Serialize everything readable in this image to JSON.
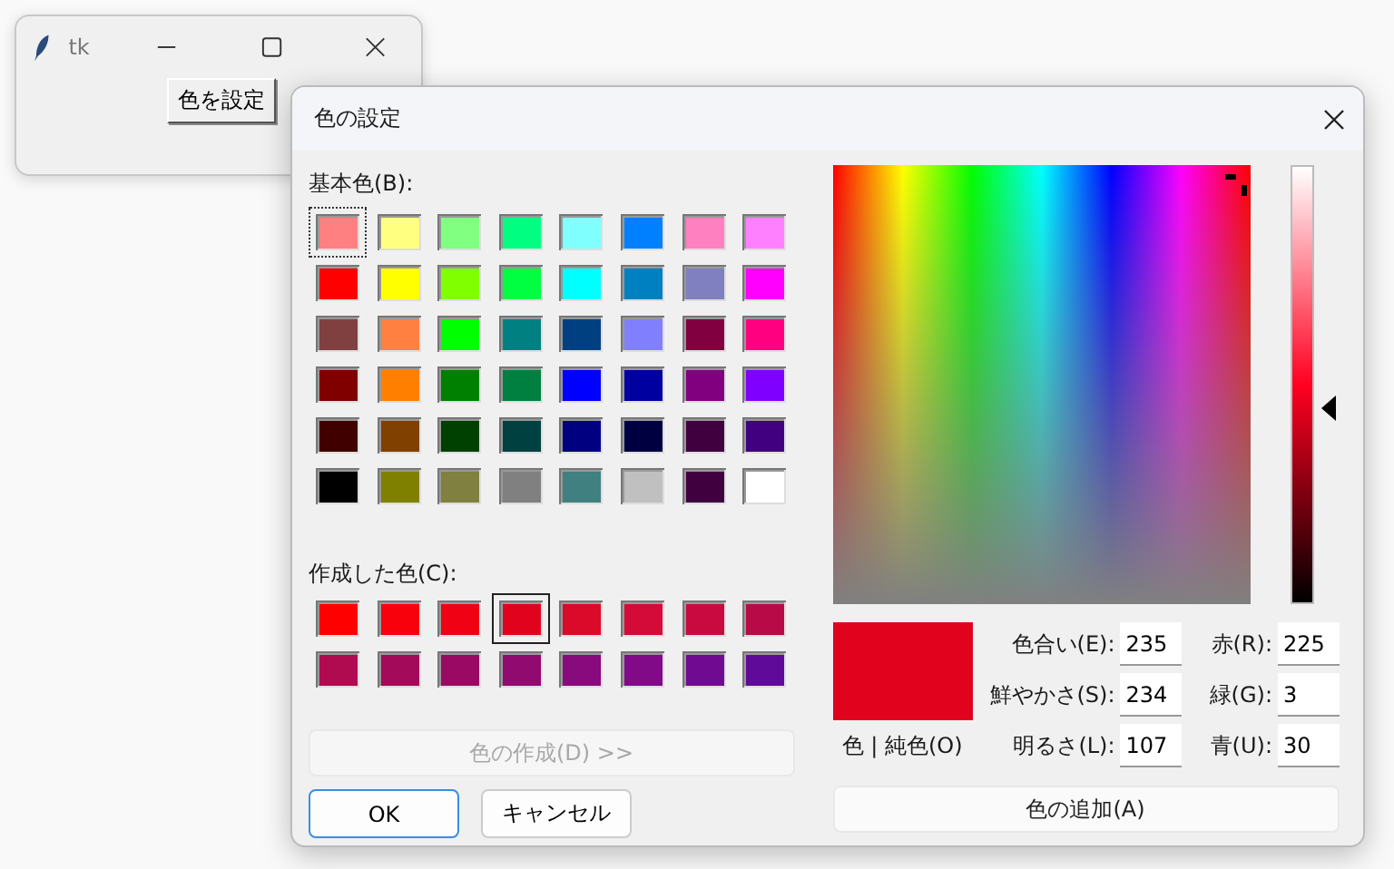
{
  "main_window": {
    "title": "tk",
    "button": "色を設定"
  },
  "dialog": {
    "title": "色の設定",
    "basic_label": "基本色(B):",
    "basic_colors": [
      {
        "color": "#ff8080",
        "selected": true
      },
      {
        "color": "#ffff80",
        "selected": false
      },
      {
        "color": "#80ff80",
        "selected": false
      },
      {
        "color": "#00ff80",
        "selected": false
      },
      {
        "color": "#80ffff",
        "selected": false
      },
      {
        "color": "#0080ff",
        "selected": false
      },
      {
        "color": "#ff80c0",
        "selected": false
      },
      {
        "color": "#ff80ff",
        "selected": false
      },
      {
        "color": "#ff0000",
        "selected": false
      },
      {
        "color": "#ffff00",
        "selected": false
      },
      {
        "color": "#80ff00",
        "selected": false
      },
      {
        "color": "#00ff40",
        "selected": false
      },
      {
        "color": "#00ffff",
        "selected": false
      },
      {
        "color": "#0080c0",
        "selected": false
      },
      {
        "color": "#8080c0",
        "selected": false
      },
      {
        "color": "#ff00ff",
        "selected": false
      },
      {
        "color": "#804040",
        "selected": false
      },
      {
        "color": "#ff8040",
        "selected": false
      },
      {
        "color": "#00ff00",
        "selected": false
      },
      {
        "color": "#008080",
        "selected": false
      },
      {
        "color": "#004080",
        "selected": false
      },
      {
        "color": "#8080ff",
        "selected": false
      },
      {
        "color": "#800040",
        "selected": false
      },
      {
        "color": "#ff0080",
        "selected": false
      },
      {
        "color": "#800000",
        "selected": false
      },
      {
        "color": "#ff8000",
        "selected": false
      },
      {
        "color": "#008000",
        "selected": false
      },
      {
        "color": "#008040",
        "selected": false
      },
      {
        "color": "#0000ff",
        "selected": false
      },
      {
        "color": "#0000a0",
        "selected": false
      },
      {
        "color": "#800080",
        "selected": false
      },
      {
        "color": "#8000ff",
        "selected": false
      },
      {
        "color": "#400000",
        "selected": false
      },
      {
        "color": "#804000",
        "selected": false
      },
      {
        "color": "#004000",
        "selected": false
      },
      {
        "color": "#004040",
        "selected": false
      },
      {
        "color": "#000080",
        "selected": false
      },
      {
        "color": "#000040",
        "selected": false
      },
      {
        "color": "#400040",
        "selected": false
      },
      {
        "color": "#400080",
        "selected": false
      },
      {
        "color": "#000000",
        "selected": false
      },
      {
        "color": "#808000",
        "selected": false
      },
      {
        "color": "#808040",
        "selected": false
      },
      {
        "color": "#808080",
        "selected": false
      },
      {
        "color": "#408080",
        "selected": false
      },
      {
        "color": "#c0c0c0",
        "selected": false
      },
      {
        "color": "#400040",
        "selected": false
      },
      {
        "color": "#ffffff",
        "selected": false
      }
    ],
    "custom_label": "作成した色(C):",
    "custom_colors": [
      {
        "color": "#ff0000",
        "selected": false
      },
      {
        "color": "#f8000c",
        "selected": false
      },
      {
        "color": "#f00214",
        "selected": false
      },
      {
        "color": "#e1031e",
        "selected": true
      },
      {
        "color": "#dc0a2a",
        "selected": false
      },
      {
        "color": "#d40a38",
        "selected": false
      },
      {
        "color": "#c80a40",
        "selected": false
      },
      {
        "color": "#b80a46",
        "selected": false
      },
      {
        "color": "#b00a50",
        "selected": false
      },
      {
        "color": "#a40a5a",
        "selected": false
      },
      {
        "color": "#9a0a64",
        "selected": false
      },
      {
        "color": "#900a70",
        "selected": false
      },
      {
        "color": "#880a7c",
        "selected": false
      },
      {
        "color": "#800a88",
        "selected": false
      },
      {
        "color": "#700a90",
        "selected": false
      },
      {
        "color": "#600a9a",
        "selected": false
      }
    ],
    "define_button": {
      "label": "色の作成(D) >>",
      "disabled": true
    },
    "ok_button": "OK",
    "cancel_button": "キャンセル",
    "preview": {
      "color": "#e1031e",
      "label": "色 | 純色(O)"
    },
    "luminance": {
      "level": 0.446
    },
    "fields": [
      {
        "label": "色合い(E):",
        "value": "235"
      },
      {
        "label": "赤(R):",
        "value": "225"
      },
      {
        "label": "鮮やかさ(S):",
        "value": "234"
      },
      {
        "label": "緑(G):",
        "value": "3"
      },
      {
        "label": "明るさ(L):",
        "value": "107"
      },
      {
        "label": "青(U):",
        "value": "30"
      }
    ],
    "add_button": "色の追加(A)"
  }
}
